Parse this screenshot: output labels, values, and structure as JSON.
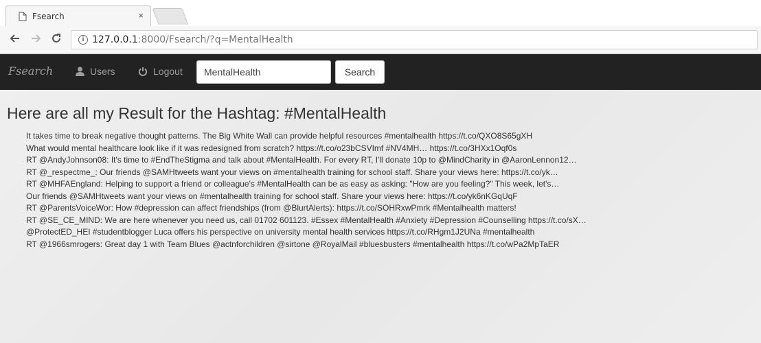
{
  "browser": {
    "tab_title": "Fsearch",
    "tab_close": "×",
    "url_host": "127.0.0.1",
    "url_rest": ":8000/Fsearch/?q=MentalHealth"
  },
  "navbar": {
    "brand": "Fsearch",
    "users_label": "Users",
    "logout_label": "Logout",
    "search_value": "MentalHealth",
    "search_button": "Search"
  },
  "main": {
    "heading": "Here are all my Result for the Hashtag: #MentalHealth",
    "results": [
      "It takes time to break negative thought patterns. The Big White Wall can provide helpful resources #mentalhealth https://t.co/QXO8S65gXH",
      "What would mental healthcare look like if it was redesigned from scratch? https://t.co/o23bCSVImf #NV4MH… https://t.co/3HXx1Oqf0s",
      "RT @AndyJohnson08: It's time to #EndTheStigma and talk about #MentalHealth. For every RT, I'll donate 10p to @MindCharity in @AaronLennon12…",
      "RT @_respectme_: Our friends @SAMHtweets want your views on #mentalhealth training for school staff. Share your views here: https://t.co/yk…",
      "RT @MHFAEngland: Helping to support a friend or colleague's #MentalHealth can be as easy as asking: \"How are you feeling?\" This week, let's…",
      "Our friends @SAMHtweets want your views on #mentalhealth training for school staff. Share your views here: https://t.co/yk6nKGqUqF",
      "RT @ParentsVoiceWor: How #depression can affect friendships (from @BlurtAlerts): https://t.co/SOHRxwPmrk #Mentalhealth matters!",
      "RT @SE_CE_MIND: We are here whenever you need us, call 01702 601123. #Essex #MentalHealth #Anxiety #Depression #Counselling https://t.co/sX…",
      "@ProtectED_HEI #studentblogger Luca offers his perspective on university mental health services https://t.co/RHgm1J2UNa #mentalhealth",
      "RT @1966smrogers: Great day 1 with Team Blues @actnforchildren @sirtone @RoyalMail #bluesbusters #mentalhealth https://t.co/wPa2MpTaER"
    ]
  }
}
